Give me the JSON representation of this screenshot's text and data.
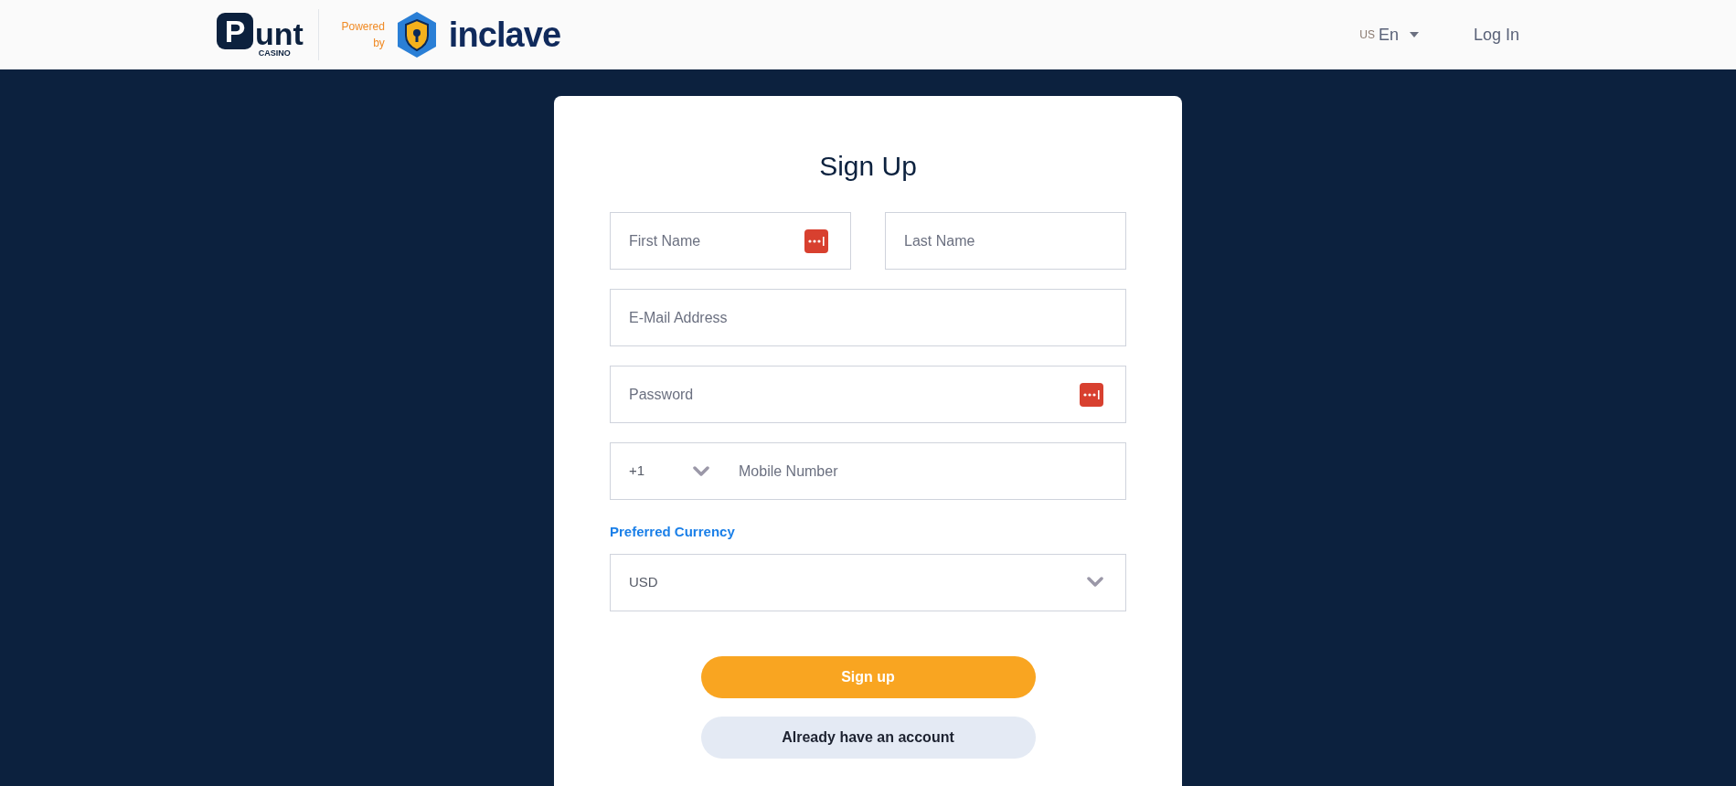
{
  "header": {
    "logo": {
      "mark": "P",
      "word": "unt",
      "sub": "CASINO"
    },
    "powered_by": "Powered by",
    "partner": "inclave",
    "language": {
      "region": "US",
      "code": "En"
    },
    "login": "Log In"
  },
  "form": {
    "title": "Sign Up",
    "fields": [
      {
        "kind": "text",
        "placeholder": "First Name",
        "autofill_icon": true,
        "half": true
      },
      {
        "kind": "text",
        "placeholder": "Last Name",
        "autofill_icon": false,
        "half": true
      },
      {
        "kind": "text",
        "placeholder": "E-Mail Address",
        "autofill_icon": false,
        "half": false
      },
      {
        "kind": "text",
        "placeholder": "Password",
        "autofill_icon": true,
        "half": false
      },
      {
        "kind": "phone",
        "prefix": "+1",
        "placeholder": "Mobile Number",
        "autofill_icon": false,
        "half": false
      }
    ],
    "currency": {
      "label": "Preferred Currency",
      "value": "USD"
    },
    "buttons": [
      {
        "kind": "primary",
        "label": "Sign up"
      },
      {
        "kind": "secondary",
        "label": "Already have an account"
      }
    ]
  }
}
